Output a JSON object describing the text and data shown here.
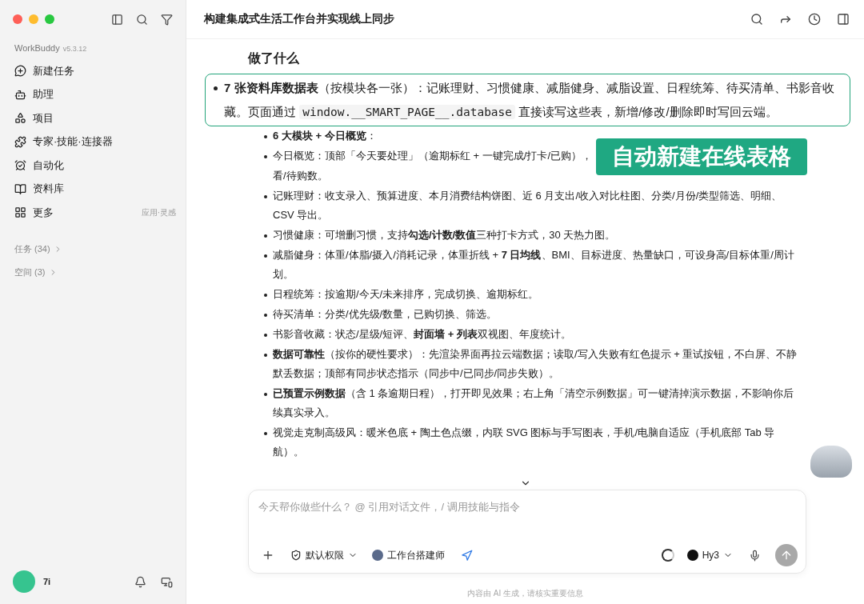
{
  "sidebar": {
    "brand": "WorkBuddy",
    "version": "v5.3.12",
    "items": [
      {
        "label": "新建任务"
      },
      {
        "label": "助理"
      },
      {
        "label": "项目"
      },
      {
        "label": "专家·技能·连接器"
      },
      {
        "label": "自动化"
      },
      {
        "label": "资料库"
      },
      {
        "label": "更多",
        "note": "应用·灵感"
      }
    ],
    "sections": [
      {
        "label": "任务 (34)"
      },
      {
        "label": "空间 (3)"
      }
    ],
    "user": {
      "name": "7i"
    }
  },
  "header": {
    "title": "构建集成式生活工作台并实现线上同步"
  },
  "content": {
    "heading": "做了什么",
    "highlight": {
      "lead": "**7 张资料库数据表**（按模块各一张）：记账理财、习惯健康、减脂健身、减脂设置、日程统筹、待买清单、书影音收藏。页面通过",
      "code": "window.__SMART_PAGE__.database",
      "tail": "直接读写这些表，新增/修改/删除即时写回云端。"
    },
    "items": [
      {
        "kind": "bullet",
        "text": "**6 大模块 + 今日概览**："
      },
      {
        "kind": "bullet",
        "text": "今日概览：顶部「今天要处理」（逾期标红 + 一键完成/打卡/已购），"
      },
      {
        "kind": "continuation",
        "text": "看/待购数。"
      },
      {
        "kind": "bullet",
        "text": "记账理财：收支录入、预算进度、本月消费结构饼图、近 6 月支出/收入对比柱图、分类/月份/类型筛选、明细、CSV 导出。"
      },
      {
        "kind": "bullet",
        "text": "习惯健康：可增删习惯，支持**勾选/计数/数值**三种打卡方式，30 天热力图。"
      },
      {
        "kind": "bullet",
        "text": "减脂健身：体重/体脂/摄入/消耗记录，体重折线 + **7 日均线**、BMI、目标进度、热量缺口，可设身高/目标体重/周计划。"
      },
      {
        "kind": "bullet",
        "text": "日程统筹：按逾期/今天/未来排序，完成切换、逾期标红。"
      },
      {
        "kind": "bullet",
        "text": "待买清单：分类/优先级/数量，已购切换、筛选。"
      },
      {
        "kind": "bullet",
        "text": "书影音收藏：状态/星级/短评、**封面墙 + 列表**双视图、年度统计。"
      },
      {
        "kind": "bullet",
        "text": "**数据可靠性**（按你的硬性要求）：先渲染界面再拉云端数据；读取/写入失败有红色提示 + 重试按钮，不白屏、不静默丢数据；顶部有同步状态指示（同步中/已同步/同步失败）。"
      },
      {
        "kind": "bullet",
        "text": "**已预置示例数据**（含 1 条逾期日程），打开即见效果；右上角「清空示例数据」可一键清掉演示数据，不影响你后续真实录入。"
      },
      {
        "kind": "bullet",
        "text": "视觉走克制高级风：暖米色底 + 陶土色点缀，内联 SVG 图标与手写图表，手机/电脑自适应（手机底部 Tab 导航）。"
      }
    ],
    "overlay_label": "自动新建在线表格"
  },
  "composer": {
    "placeholder": "今天帮你做些什么？ @ 引用对话文件，/ 调用技能与指令",
    "permission": "默认权限",
    "agent": "工作台搭建师",
    "model": "Hy3"
  },
  "footer_note": "内容由 AI 生成，请核实重要信息"
}
